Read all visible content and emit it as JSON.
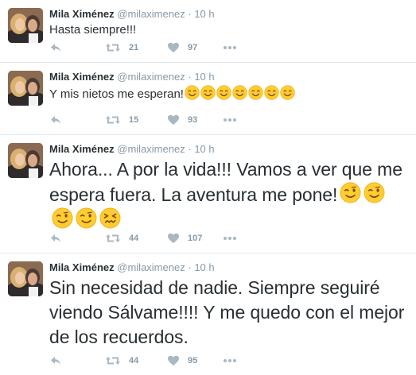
{
  "tweets": [
    {
      "name": "Mila Ximénez",
      "handle": "@milaximenez",
      "separator": "·",
      "time": "10 h",
      "text": "Hasta siempre!!!",
      "emoji_after": [],
      "retweets": "21",
      "likes": "97"
    },
    {
      "name": "Mila Ximénez",
      "handle": "@milaximenez",
      "separator": "·",
      "time": "10 h",
      "text": "Y mis nietos me esperan!",
      "emoji_after": [
        "smiling-face",
        "smiling-face",
        "smiling-face",
        "smiling-face",
        "smiling-face",
        "smiling-face",
        "smiling-face"
      ],
      "retweets": "15",
      "likes": "93"
    },
    {
      "name": "Mila Ximénez",
      "handle": "@milaximenez",
      "separator": "·",
      "time": "10 h",
      "text": "Ahora... A por la vida!!! Vamos a ver que me espera fuera. La aventura me pone!",
      "emoji_after": [
        "winking-face",
        "winking-face",
        "winking-face",
        "winking-face",
        "confounded-face"
      ],
      "retweets": "44",
      "likes": "107"
    },
    {
      "name": "Mila Ximénez",
      "handle": "@milaximenez",
      "separator": "·",
      "time": "10 h",
      "text": "Sin necesidad de nadie. Siempre seguiré viendo Sálvame!!!! Y me quedo con el mejor de los recuerdos.",
      "emoji_after": [],
      "retweets": "44",
      "likes": "95"
    }
  ],
  "icons": {
    "reply": "reply-icon",
    "retweet": "retweet-icon",
    "like": "heart-icon",
    "more": "more-dots-icon"
  },
  "colors": {
    "text": "#292f33",
    "muted": "#8899a6",
    "divider": "#e1e8ed",
    "emoji": "#ffcc33"
  }
}
